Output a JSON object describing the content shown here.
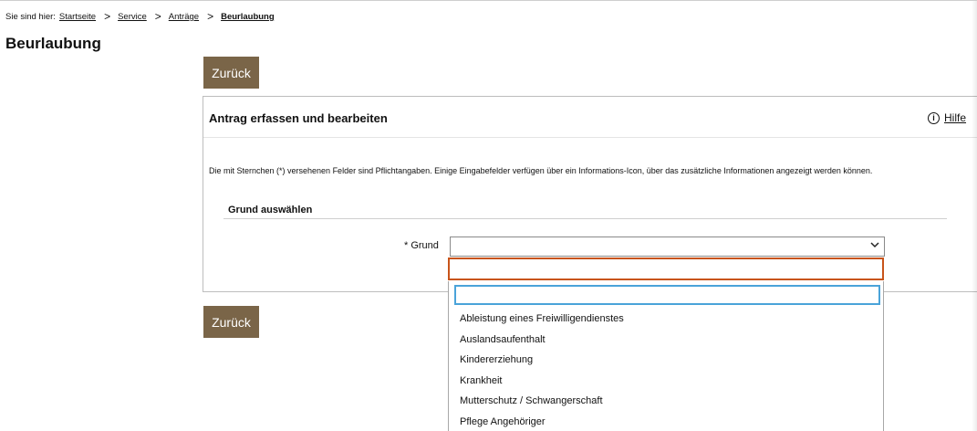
{
  "breadcrumb": {
    "label": "Sie sind hier:",
    "items": [
      "Startseite",
      "Service",
      "Anträge"
    ],
    "current": "Beurlaubung",
    "separator": ">"
  },
  "page": {
    "title": "Beurlaubung"
  },
  "buttons": {
    "back_label": "Zurück"
  },
  "panel": {
    "title": "Antrag erfassen und bearbeiten",
    "help_label": "Hilfe",
    "info_text": "Die mit Sternchen (*) versehenen Felder sind Pflichtangaben. Einige Eingabefelder verfügen über ein Informations-Icon, über das zusätzliche Informationen angezeigt werden können."
  },
  "section": {
    "title": "Grund auswählen"
  },
  "field": {
    "label": "* Grund",
    "value": ""
  },
  "dropdown": {
    "search_value": "",
    "options": [
      "Ableistung eines Freiwilligendienstes",
      "Auslandsaufenthalt",
      "Kindererziehung",
      "Krankheit",
      "Mutterschutz / Schwangerschaft",
      "Pflege Angehöriger"
    ]
  },
  "colors": {
    "button_bg": "#7a6548",
    "highlight_border": "#c8541a",
    "search_focus_border": "#4aa3d9"
  },
  "icons": {
    "help": "info-circle-icon",
    "chevron": "chevron-down-icon"
  }
}
